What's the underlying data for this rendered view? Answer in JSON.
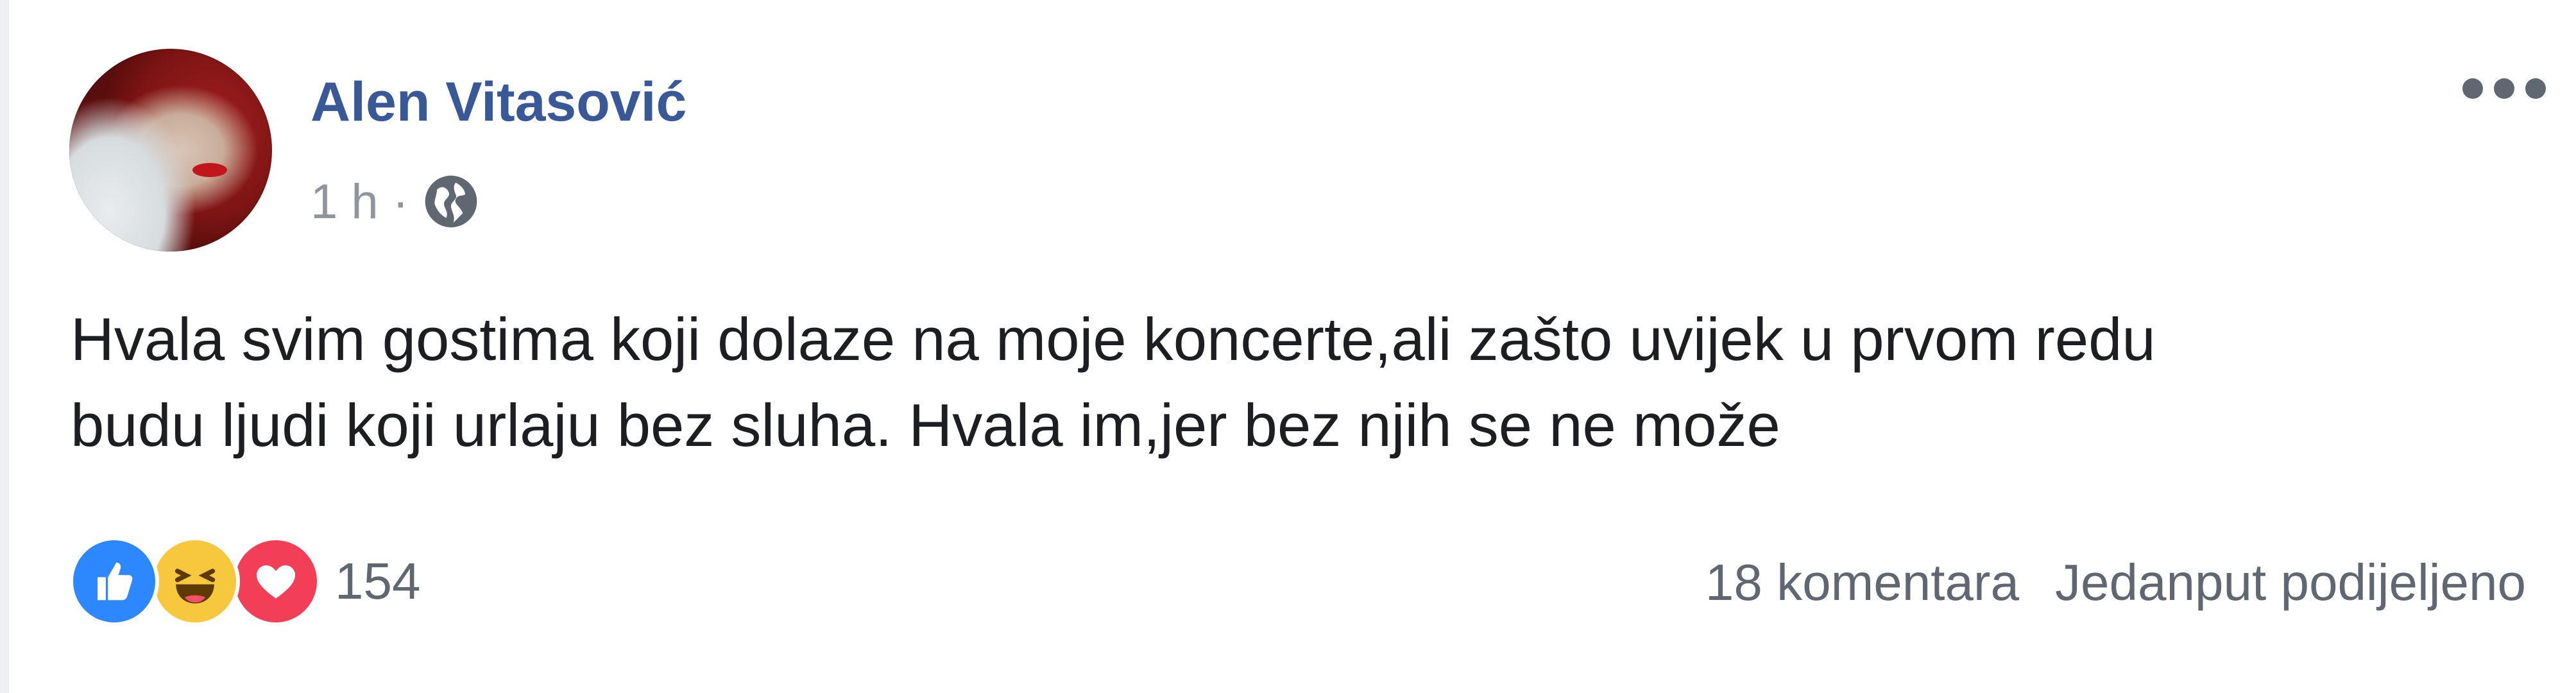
{
  "post": {
    "author": "Alen Vitasović",
    "time": "1 h",
    "separator": "·",
    "privacy_icon": "globe-icon",
    "menu_icon": "more-options-icon",
    "text": "Hvala svim gostima koji dolaze na moje koncerte,ali zašto uvijek u prvom redu\nbudu ljudi koji urlaju bez sluha. Hvala im,jer bez njih se ne može"
  },
  "reactions": {
    "icons": [
      "like-icon",
      "haha-icon",
      "love-icon"
    ],
    "count": "154"
  },
  "stats": {
    "comments": "18 komentara",
    "shares": "Jedanput podijeljeno"
  },
  "colors": {
    "author": "#385898",
    "meta": "#90949c",
    "text": "#1c1e21",
    "like": "#2d88ff",
    "haha": "#f7c83e",
    "love": "#f33e58"
  }
}
